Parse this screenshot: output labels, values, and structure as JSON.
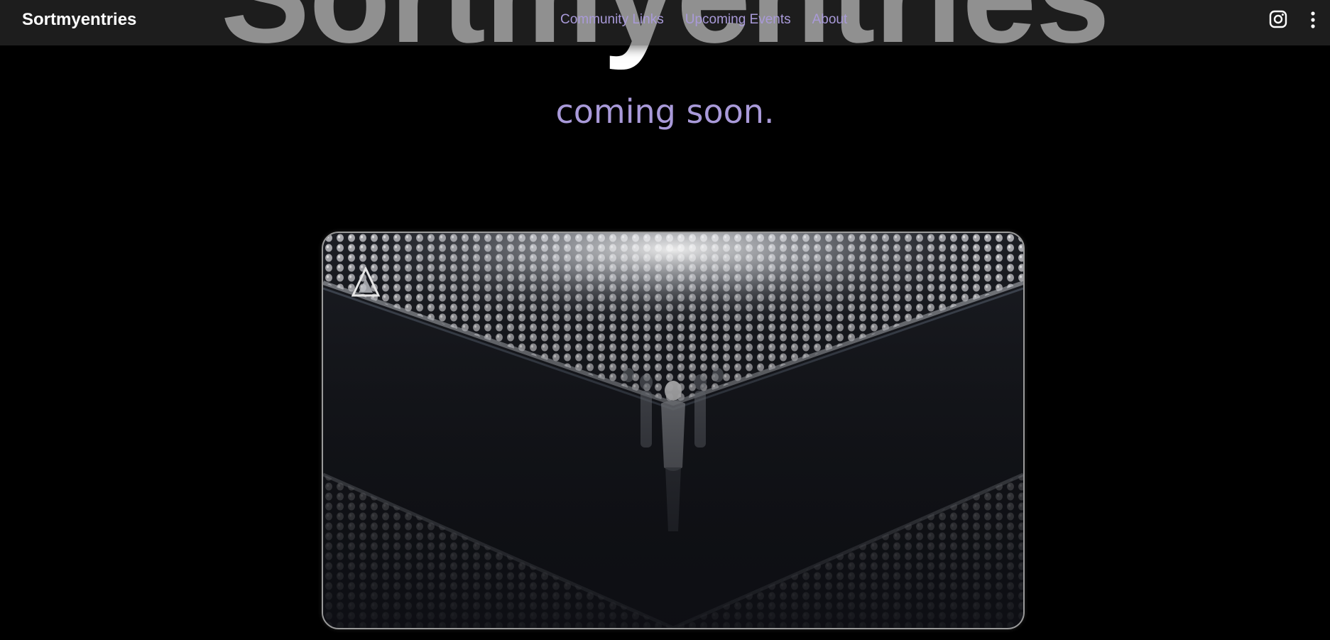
{
  "header": {
    "brand": "Sortmyentries",
    "nav": [
      {
        "label": "Community Links"
      },
      {
        "label": "Upcoming Events"
      },
      {
        "label": "About"
      }
    ],
    "icons": {
      "social": "instagram-icon",
      "menu": "more-vertical-icon"
    }
  },
  "hero": {
    "title": "Sortmyentries",
    "subtitle": "coming soon."
  },
  "media": {
    "type": "video",
    "logo_icon": "triangle-logo-icon"
  },
  "colors": {
    "background": "#000000",
    "accent": "#a99ad9",
    "header_bg": "#343434",
    "card_border": "#9a9a9a"
  }
}
